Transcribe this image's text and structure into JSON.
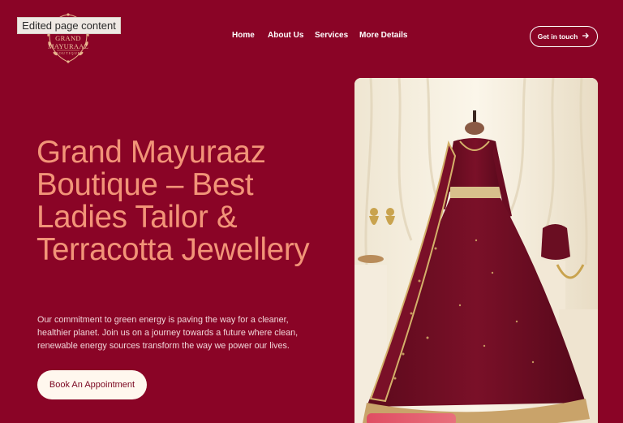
{
  "editor": {
    "badge": "Edited page content"
  },
  "logo": {
    "line1": "GRAND",
    "line2": "MAYURAAZ",
    "line3": "BOUTIQUE"
  },
  "nav": {
    "items": [
      {
        "label": "Home"
      },
      {
        "label": "About Us"
      },
      {
        "label": "Services"
      },
      {
        "label": "More Details"
      }
    ],
    "cta": {
      "label": "Get in touch",
      "icon": "arrow-right-icon"
    }
  },
  "hero": {
    "title": "Grand Mayuraaz Boutique – Best Ladies Tailor & Terracotta Jewellery",
    "description": "Our commitment to green energy is paving the way for a cleaner, healthier planet. Join us on a journey towards a future where clean, renewable energy sources transform the way we power our lives.",
    "button": "Book An Appointment"
  },
  "colors": {
    "background": "#8a0426",
    "title": "#f29478",
    "button_bg": "#fff7ee",
    "accent_pink": "#e04d63"
  }
}
